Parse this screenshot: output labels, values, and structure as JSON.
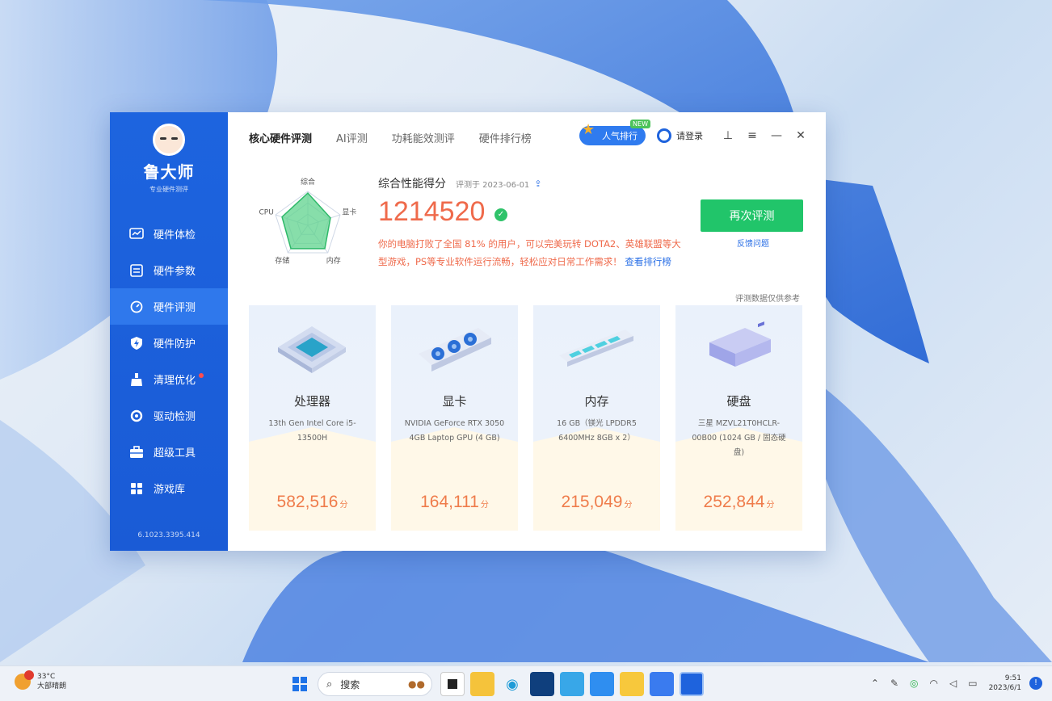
{
  "app": {
    "logo_name": "鲁大师",
    "logo_sub": "专业硬件测评",
    "version": "6.1023.3395.414"
  },
  "sidebar": {
    "items": [
      {
        "label": "硬件体检",
        "icon": "chart-monitor-icon"
      },
      {
        "label": "硬件参数",
        "icon": "list-icon"
      },
      {
        "label": "硬件评测",
        "icon": "gauge-icon"
      },
      {
        "label": "硬件防护",
        "icon": "shield-icon"
      },
      {
        "label": "清理优化",
        "icon": "broom-icon"
      },
      {
        "label": "驱动检测",
        "icon": "refresh-icon"
      },
      {
        "label": "超级工具",
        "icon": "toolbox-icon"
      },
      {
        "label": "游戏库",
        "icon": "grid-icon"
      }
    ],
    "active_index": 2
  },
  "tabs": [
    "核心硬件评测",
    "AI评测",
    "功耗能效测评",
    "硬件排行榜"
  ],
  "topbar": {
    "rank_label": "人气排行",
    "rank_tag": "NEW",
    "user_label": "请登录"
  },
  "score": {
    "title": "综合性能得分",
    "date": "评测于 2023-06-01",
    "value": "1214520",
    "description": "你的电脑打败了全国 81% 的用户，可以完美玩转 DOTA2、英雄联盟等大型游戏，PS等专业软件运行流畅，轻松应对日常工作需求！",
    "link_text": "查看排行榜",
    "retest_label": "再次评测",
    "feedback_label": "反馈问题",
    "rank_note": "评测数据仅供参考"
  },
  "radar": {
    "labels": [
      "综合",
      "显卡",
      "内存",
      "存储",
      "CPU"
    ],
    "values": [
      0.95,
      0.7,
      0.85,
      0.85,
      0.8
    ]
  },
  "cards": [
    {
      "title": "处理器",
      "desc": "13th Gen Intel Core i5-13500H",
      "score": "582,516"
    },
    {
      "title": "显卡",
      "desc": "NVIDIA GeForce RTX 3050 4GB Laptop GPU (4 GB)",
      "score": "164,111"
    },
    {
      "title": "内存",
      "desc": "16 GB（镁光 LPDDR5 6400MHz 8GB x 2）",
      "score": "215,049"
    },
    {
      "title": "硬盘",
      "desc": "三星 MZVL21T0HCLR-00B00 (1024 GB / 固态硬盘)",
      "score": "252,844"
    }
  ],
  "score_unit": "分",
  "taskbar": {
    "weather_temp": "33°C",
    "weather_text": "大部晴朗",
    "search_text": "搜索",
    "time": "9:51",
    "date": "2023/6/1"
  }
}
